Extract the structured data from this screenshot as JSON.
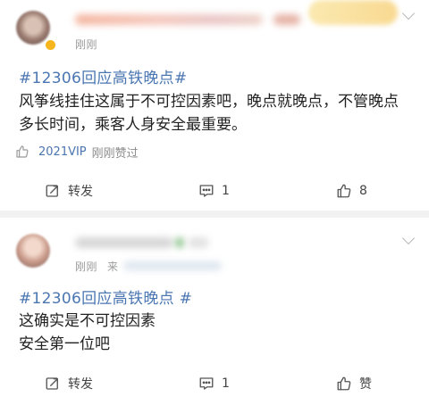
{
  "posts": [
    {
      "time": "刚刚",
      "hashtag": "#12306回应高铁晚点#",
      "content": "风筝线挂住这属于不可控因素吧，晚点就晚点，不管晚点多长时间，乘客人身安全最重要。",
      "liked_by": {
        "badge": "2021VIP",
        "text": "刚刚赞过"
      },
      "actions": {
        "repost": "转发",
        "comment_count": "1",
        "like_count": "8"
      }
    },
    {
      "time": "刚刚",
      "from_label": "来",
      "hashtag": "#12306回应高铁晚点 #",
      "content": "这确实是不可控因素\n安全第一位吧",
      "actions": {
        "repost": "转发",
        "comment_count": "1",
        "like_label": "赞"
      }
    }
  ],
  "colors": {
    "link": "#4a76b1",
    "muted": "#9a9a9a",
    "text": "#222222",
    "separator": "#f2f2f2"
  },
  "icons": {
    "repost": "repost-icon",
    "comment": "comment-icon",
    "like": "thumbs-up-icon",
    "more": "chevron-down-icon",
    "vip": "vip-badge-icon"
  }
}
